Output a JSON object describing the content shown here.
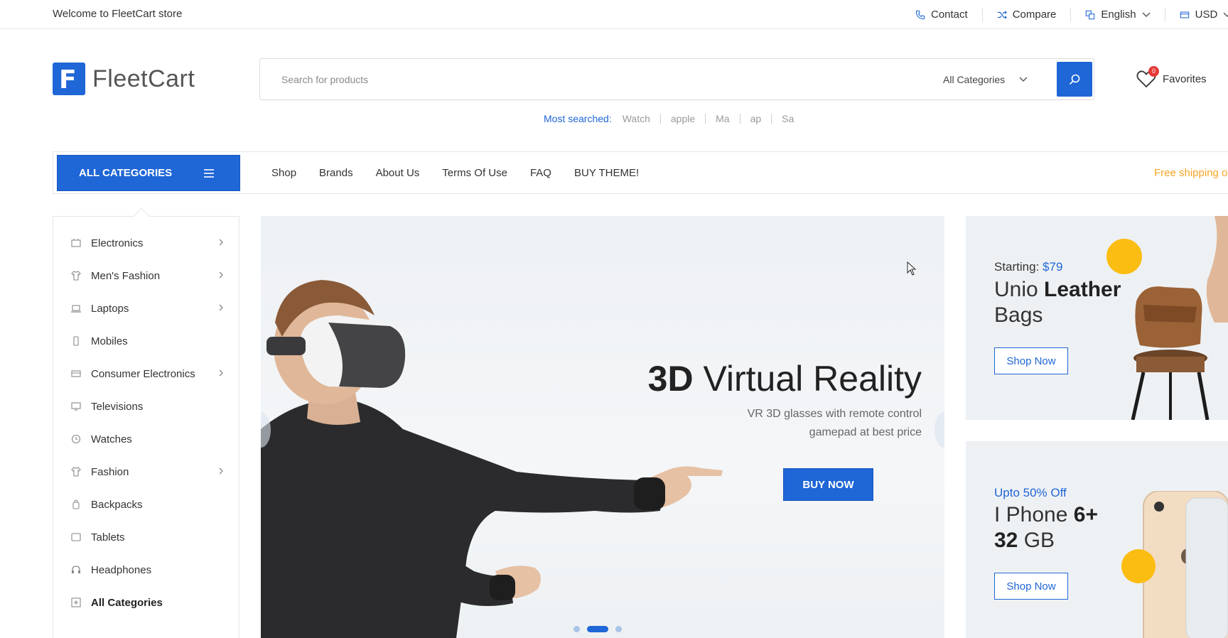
{
  "topbar": {
    "welcome": "Welcome to FleetCart store",
    "contact": "Contact",
    "compare": "Compare",
    "language": "English",
    "currency": "USD"
  },
  "header": {
    "logo_text": "FleetCart",
    "logo_letter": "F",
    "search_placeholder": "Search for products",
    "category_select": "All Categories",
    "favorites_label": "Favorites",
    "favorites_count": "0"
  },
  "most_searched": {
    "label": "Most searched:",
    "terms": [
      "Watch",
      "apple",
      "Ma",
      "ap",
      "Sa"
    ]
  },
  "nav": {
    "all_categories": "ALL CATEGORIES",
    "links": [
      "Shop",
      "Brands",
      "About Us",
      "Terms Of Use",
      "FAQ",
      "BUY THEME!"
    ],
    "free_shipping": "Free shipping o"
  },
  "sidebar": {
    "items": [
      {
        "label": "Electronics",
        "icon": "electronics-icon",
        "has_children": true
      },
      {
        "label": "Men's Fashion",
        "icon": "shirt-icon",
        "has_children": true
      },
      {
        "label": "Laptops",
        "icon": "laptop-icon",
        "has_children": true
      },
      {
        "label": "Mobiles",
        "icon": "mobile-icon",
        "has_children": false
      },
      {
        "label": "Consumer Electronics",
        "icon": "consumer-electronics-icon",
        "has_children": true
      },
      {
        "label": "Televisions",
        "icon": "tv-icon",
        "has_children": false
      },
      {
        "label": "Watches",
        "icon": "watch-icon",
        "has_children": false
      },
      {
        "label": "Fashion",
        "icon": "shirt-icon",
        "has_children": true
      },
      {
        "label": "Backpacks",
        "icon": "backpack-icon",
        "has_children": false
      },
      {
        "label": "Tablets",
        "icon": "tablet-icon",
        "has_children": false
      },
      {
        "label": "Headphones",
        "icon": "headphones-icon",
        "has_children": false
      },
      {
        "label": "All Categories",
        "icon": "plus-square-icon",
        "has_children": false
      }
    ]
  },
  "hero": {
    "title_bold": "3D",
    "title_rest": " Virtual Reality",
    "subtitle_line1": "VR 3D glasses with remote control",
    "subtitle_line2": "gamepad at best price",
    "cta": "BUY NOW",
    "slides": 3,
    "active_slide": 2
  },
  "banners": {
    "bags": {
      "pre_label": "Starting: ",
      "price": "$79",
      "title_normal": "Unio ",
      "title_bold": "Leather",
      "title_line2": "Bags",
      "cta": "Shop Now"
    },
    "phone": {
      "pre_label": "Upto 50% Off",
      "title_normal": "I Phone ",
      "title_bold": "6+",
      "title_line2_bold": "32",
      "title_line2_rest": " GB",
      "cta": "Shop Now"
    }
  },
  "colors": {
    "accent": "#1f66d6",
    "badge": "#e53935",
    "free_shipping": "#f5a623",
    "yellow_dot": "#fbbd11"
  }
}
